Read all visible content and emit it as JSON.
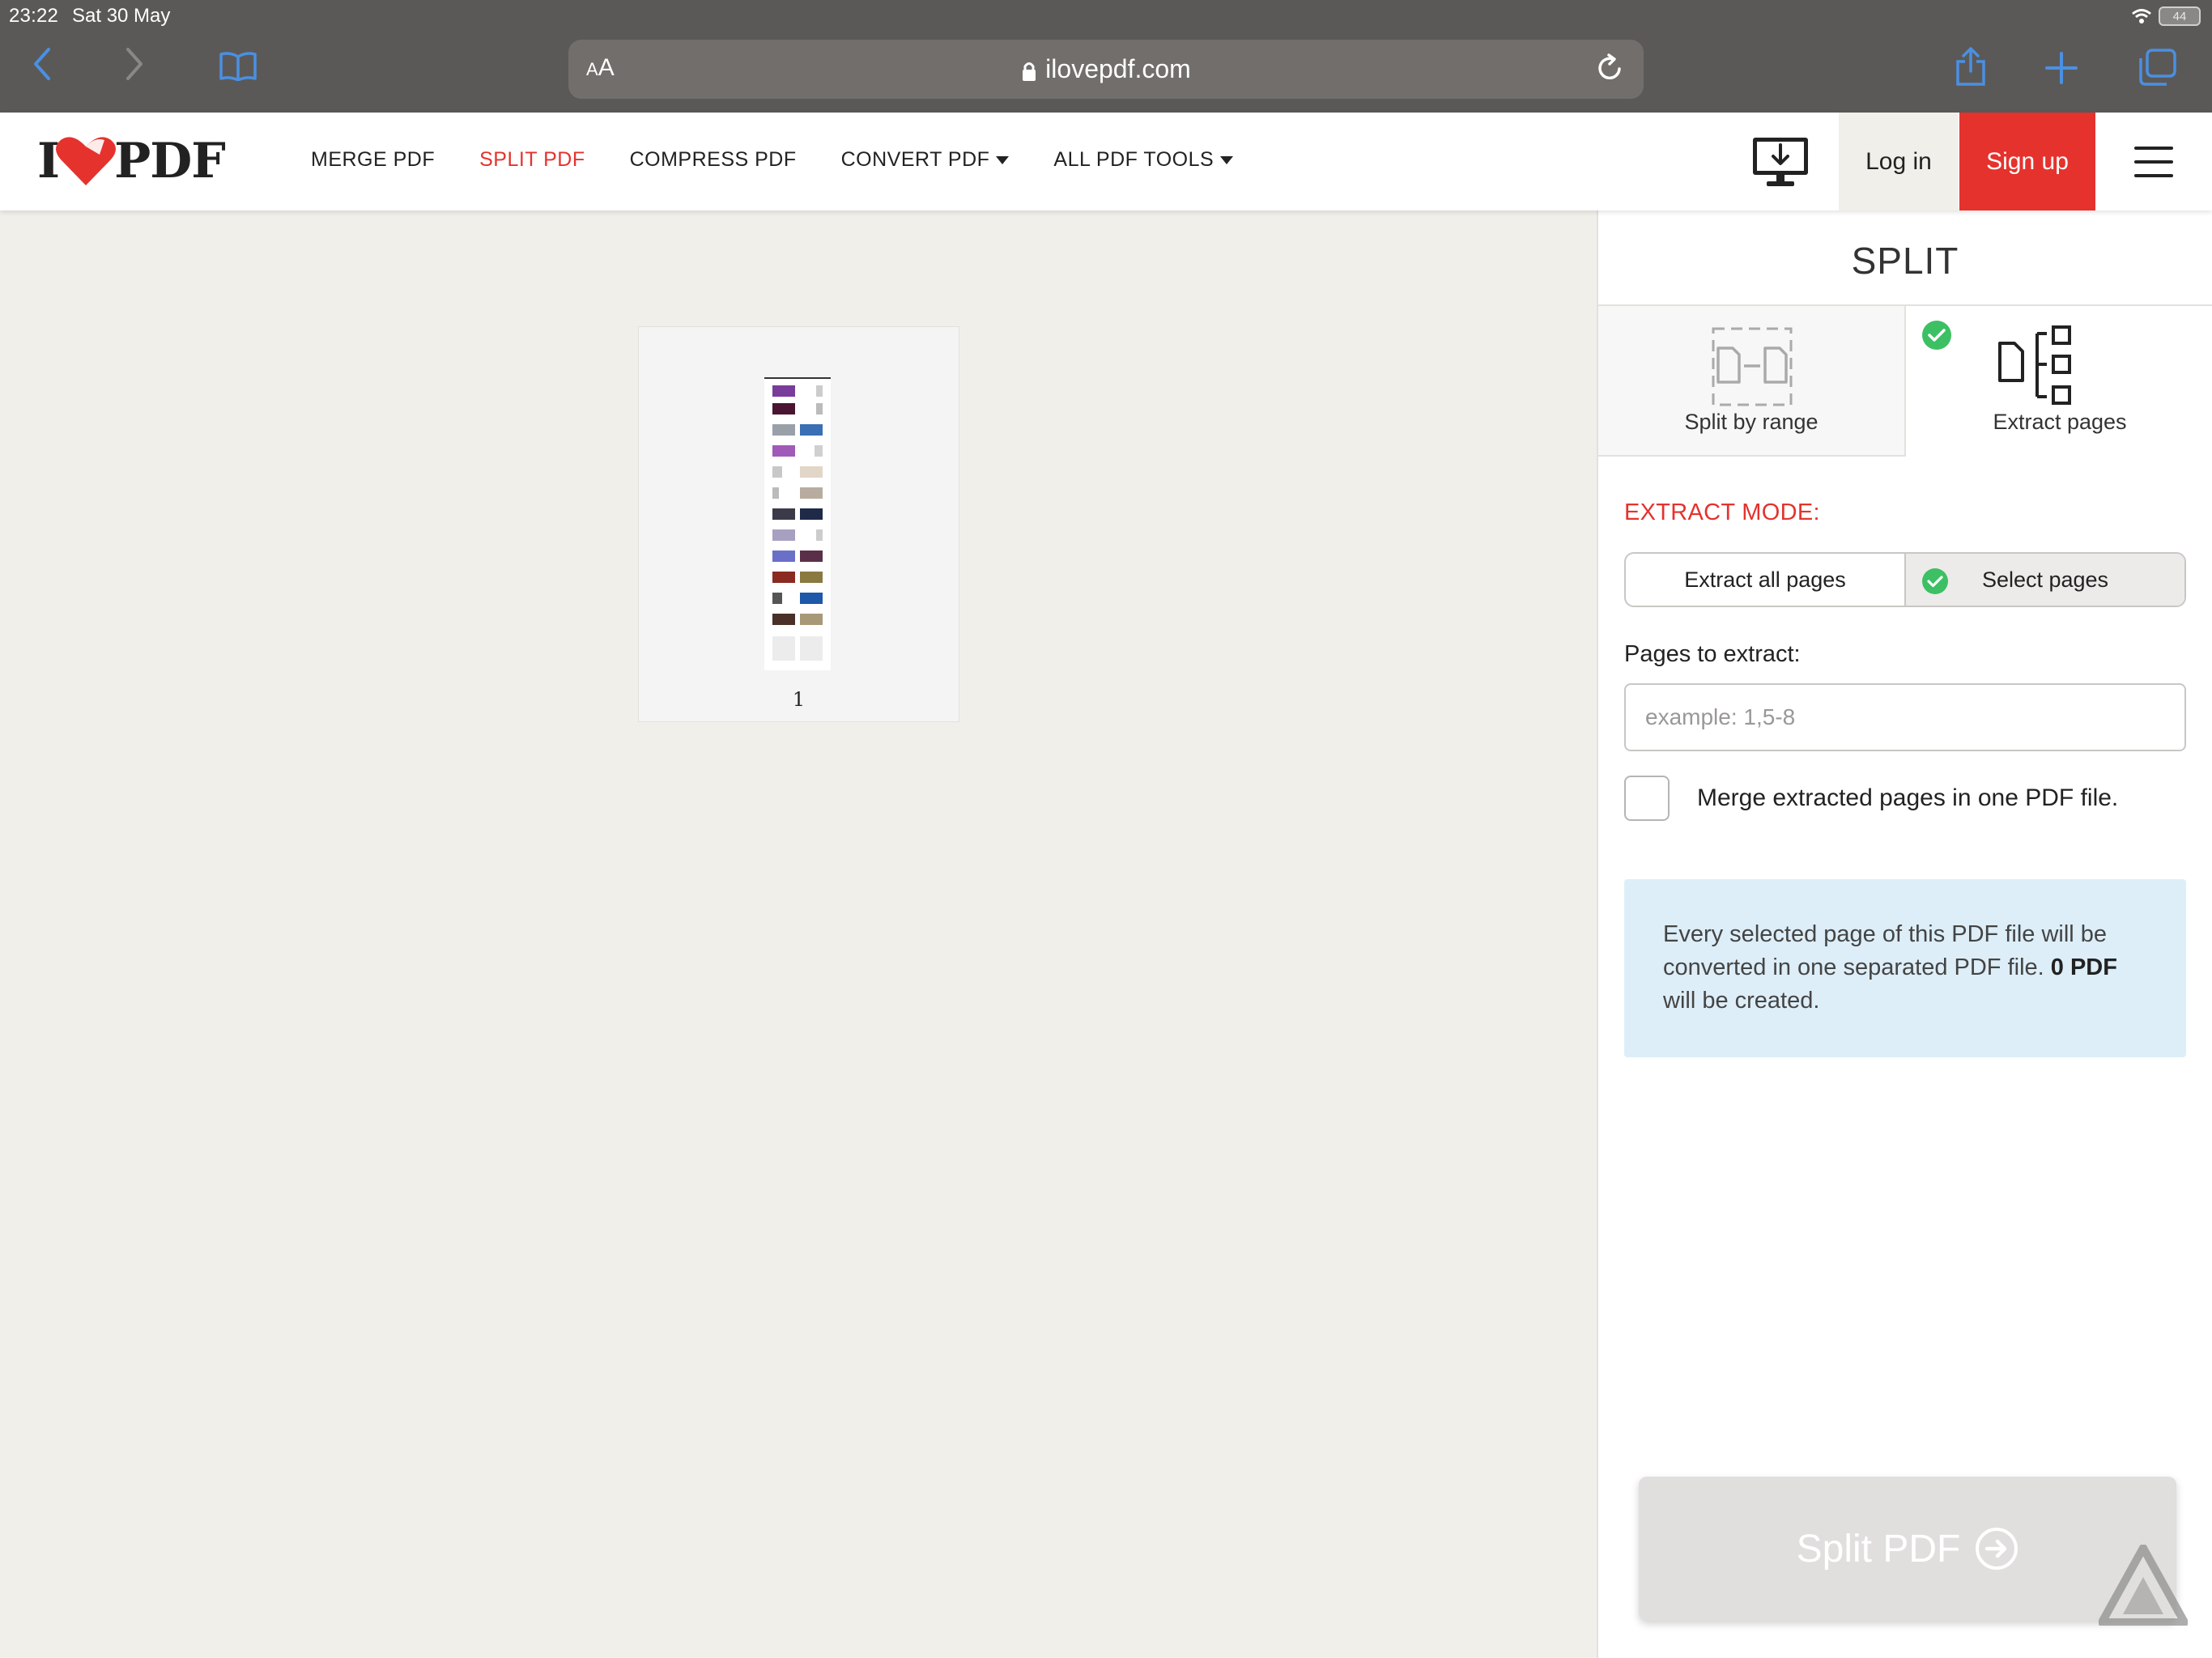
{
  "status_bar": {
    "time": "23:22",
    "date": "Sat 30 May",
    "battery": "44"
  },
  "browser": {
    "url_aa_small": "A",
    "url_aa_big": "A",
    "url": "ilovepdf.com"
  },
  "header": {
    "logo_left": "I",
    "logo_right": "PDF",
    "nav": {
      "merge": "MERGE PDF",
      "split": "SPLIT PDF",
      "compress": "COMPRESS PDF",
      "convert": "CONVERT PDF",
      "all_tools": "ALL PDF TOOLS"
    },
    "login": "Log in",
    "signup": "Sign up"
  },
  "workspace": {
    "page_number": "1"
  },
  "sidebar": {
    "title": "SPLIT",
    "tab_range": "Split by range",
    "tab_extract": "Extract pages",
    "extract_mode_label": "EXTRACT MODE:",
    "mode_all": "Extract all pages",
    "mode_select": "Select pages",
    "pages_label": "Pages to extract:",
    "pages_placeholder": "example: 1,5-8",
    "merge_label": "Merge extracted pages in one PDF file.",
    "info_text": "Every selected page of this PDF file will be converted in one separated PDF file.",
    "info_count": "0 PDF",
    "info_tail": "will be created.",
    "split_button": "Split PDF"
  },
  "colors": {
    "brand_red": "#e5322d",
    "check_green": "#3cc063",
    "info_bg": "#ddeef8"
  }
}
